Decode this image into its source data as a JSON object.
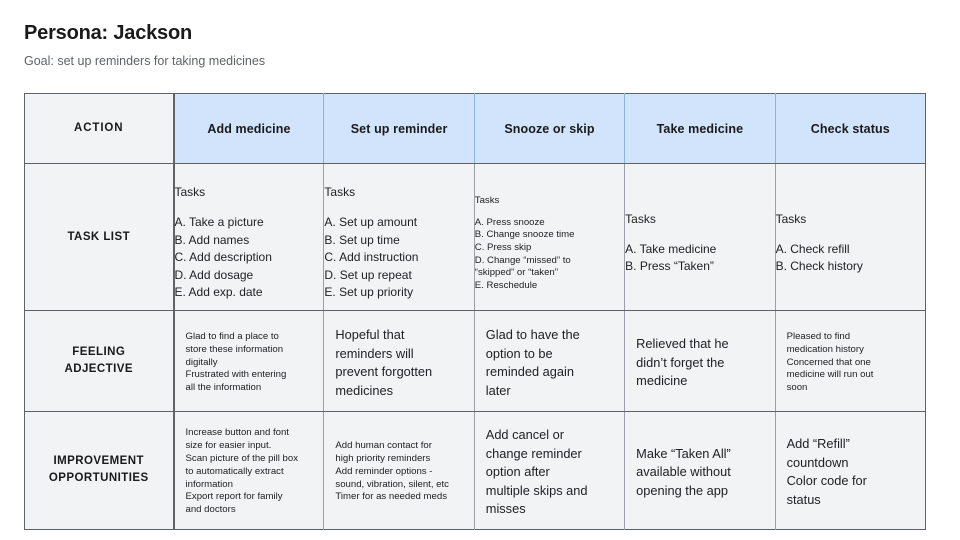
{
  "heading": {
    "persona_title": "Persona: Jackson",
    "goal": "Goal: set up reminders for taking medicines"
  },
  "colors": {
    "header_blue": "#d2e3fc",
    "cell_gray": "#f1f3f4",
    "border_dark": "#5f6368",
    "text": "#202124",
    "muted_text": "#5f6368"
  },
  "table": {
    "header": {
      "row_label": "ACTION",
      "stages": [
        "Add medicine",
        "Set up reminder",
        "Snooze or skip",
        "Take medicine",
        "Check status"
      ]
    },
    "rows": [
      {
        "label": "TASK LIST",
        "cells": [
          {
            "heading": "Tasks",
            "size": "normal",
            "items": [
              "A. Take a picture",
              "B. Add names",
              "C. Add description",
              "D. Add dosage",
              "E. Add exp. date"
            ]
          },
          {
            "heading": "Tasks",
            "size": "normal",
            "items": [
              "A. Set up amount",
              "B. Set up time",
              "C. Add instruction",
              "D. Set up repeat",
              "E. Set up priority"
            ]
          },
          {
            "heading": "Tasks",
            "size": "small",
            "items": [
              "A. Press snooze",
              "B. Change snooze time",
              "C. Press skip",
              "D. Change “missed” to\n“skipped” or “taken”",
              "E. Reschedule"
            ]
          },
          {
            "heading": "Tasks",
            "size": "normal",
            "items": [
              "A. Take medicine",
              "B. Press “Taken”"
            ]
          },
          {
            "heading": "Tasks",
            "size": "normal",
            "items": [
              "A. Check refill",
              "B. Check history"
            ]
          }
        ]
      },
      {
        "label": "FEELING\nADJECTIVE",
        "label_lines": [
          "FEELING",
          "ADJECTIVE"
        ],
        "cells": [
          {
            "size": "small",
            "lines": [
              "Glad to find a place to",
              "store these information",
              "digitally",
              "Frustrated with entering",
              "all the information"
            ]
          },
          {
            "size": "normal",
            "lines": [
              "Hopeful that",
              "reminders will",
              "prevent forgotten",
              "medicines"
            ]
          },
          {
            "size": "normal",
            "lines": [
              "Glad to have the",
              "option to be",
              "reminded again",
              "later"
            ]
          },
          {
            "size": "normal",
            "lines": [
              "Relieved that he",
              "didn’t forget the",
              "medicine"
            ]
          },
          {
            "size": "small",
            "lines": [
              "Pleased to find",
              "medication history",
              "Concerned that one",
              "medicine will run out",
              "soon"
            ]
          }
        ]
      },
      {
        "label": "IMPROVEMENT\nOPPORTUNITIES",
        "label_lines": [
          "IMPROVEMENT",
          "OPPORTUNITIES"
        ],
        "cells": [
          {
            "size": "small",
            "lines": [
              "Increase button and font",
              "size for easier input.",
              "Scan picture of the pill box",
              "to automatically extract",
              "information",
              "Export report for family",
              "and doctors"
            ]
          },
          {
            "size": "small",
            "lines": [
              "Add human contact for",
              "high priority reminders",
              "Add reminder options -",
              "sound, vibration, silent, etc",
              "Timer for as needed meds"
            ]
          },
          {
            "size": "normal",
            "lines": [
              "Add cancel or",
              "change reminder",
              "option after",
              "multiple skips and",
              "misses"
            ]
          },
          {
            "size": "normal",
            "lines": [
              "Make “Taken All”",
              "available without",
              "opening the app"
            ]
          },
          {
            "size": "normal",
            "lines": [
              "Add “Refill”",
              "countdown",
              "Color code for",
              "status"
            ]
          }
        ]
      }
    ]
  }
}
